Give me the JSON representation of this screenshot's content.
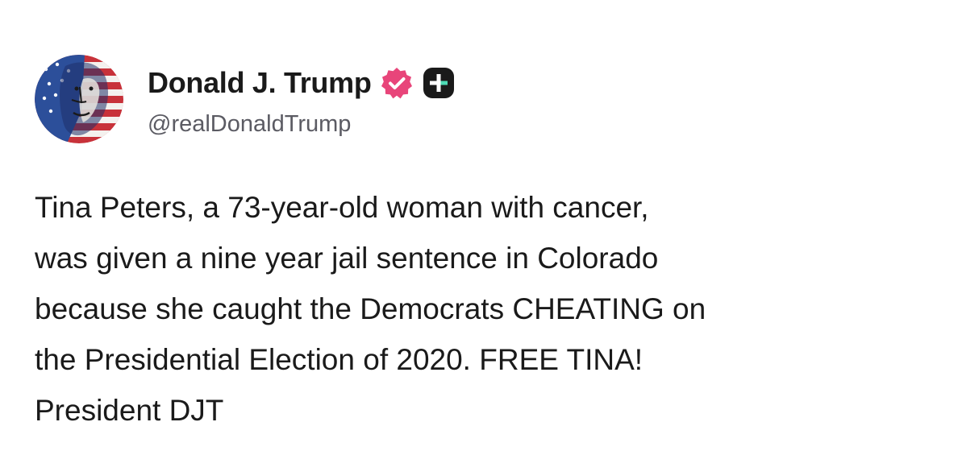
{
  "author": {
    "display_name": "Donald J. Trump",
    "handle": "@realDonaldTrump",
    "avatar_icon": "flag-painted-portrait-avatar",
    "verified_icon": "verified-badge-icon",
    "verified_color": "#e8457a",
    "badge_icon": "plus-badge-icon",
    "badge_color": "#1a1a1a"
  },
  "post": {
    "lines": [
      "Tina Peters, a 73-year-old woman with cancer,",
      "was given a nine year jail sentence in Colorado",
      "because she caught the Democrats CHEATING on",
      "the Presidential Election of 2020. FREE TINA!",
      "President DJT"
    ]
  }
}
